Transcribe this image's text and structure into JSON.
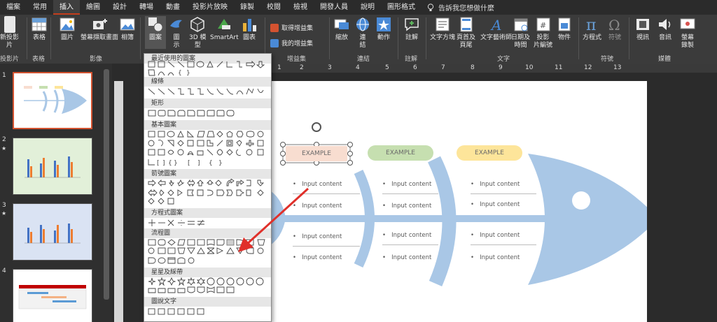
{
  "tabs": [
    "檔案",
    "常用",
    "插入",
    "繪圖",
    "設計",
    "轉場",
    "動畫",
    "投影片放映",
    "錄製",
    "校閱",
    "檢視",
    "開發人員",
    "說明",
    "圖形格式"
  ],
  "active_tab_index": 2,
  "tellme": "告訴我您想做什麼",
  "ribbon": {
    "new_slide": "新投影\n片",
    "table": "表格",
    "picture": "圖片",
    "screenshot": "螢幕擷取畫面",
    "album": "相簿",
    "shapes": "圖案",
    "icons": "圖\n示",
    "model3d": "3D 模\n型",
    "smartart": "SmartArt",
    "chart": "圖表",
    "get_addins": "取得增益集",
    "my_addins": "我的增益集",
    "zoom": "縮放",
    "link": "連\n結",
    "action": "動作",
    "comment": "註解",
    "textbox": "文字方塊",
    "header_footer": "頁首及\n頁尾",
    "wordart": "文字藝術師",
    "datetime": "日期及\n時間",
    "slide_number": "投影\n片編號",
    "object": "物件",
    "equation": "方程式",
    "symbol": "符號",
    "video": "視訊",
    "audio": "音訊",
    "screen_record": "螢幕\n錄製",
    "groups": {
      "slides": "投影片",
      "tables": "表格",
      "images": "影像",
      "addins": "增益集",
      "links": "連結",
      "comments": "註解",
      "text": "文字",
      "symbols": "符號",
      "media": "媒體"
    }
  },
  "shapes_menu": {
    "recent": "最近使用的圖案",
    "lines": "線條",
    "rectangles": "矩形",
    "basic": "基本圖案",
    "arrows": "箭號圖案",
    "equation": "方程式圖案",
    "flowchart": "流程圖",
    "stars": "星星及綵帶",
    "callouts": "圖說文字"
  },
  "slide_numbers": [
    "1",
    "2",
    "3",
    "4"
  ],
  "ruler_numbers": [
    "1",
    "2",
    "3",
    "4",
    "5",
    "6",
    "7",
    "8",
    "9",
    "10",
    "11",
    "12",
    "13"
  ],
  "slide": {
    "pills": [
      "EXAMPLE",
      "EXAMPLE",
      "EXAMPLE"
    ],
    "input": "Input content"
  },
  "colors": {
    "fish": "#a9c7e6",
    "pill1": "#f8ddd0",
    "pill2": "#c6dfb0",
    "pill3": "#fde59a",
    "arrow": "#e0302a",
    "accent": "#c43e1c"
  }
}
